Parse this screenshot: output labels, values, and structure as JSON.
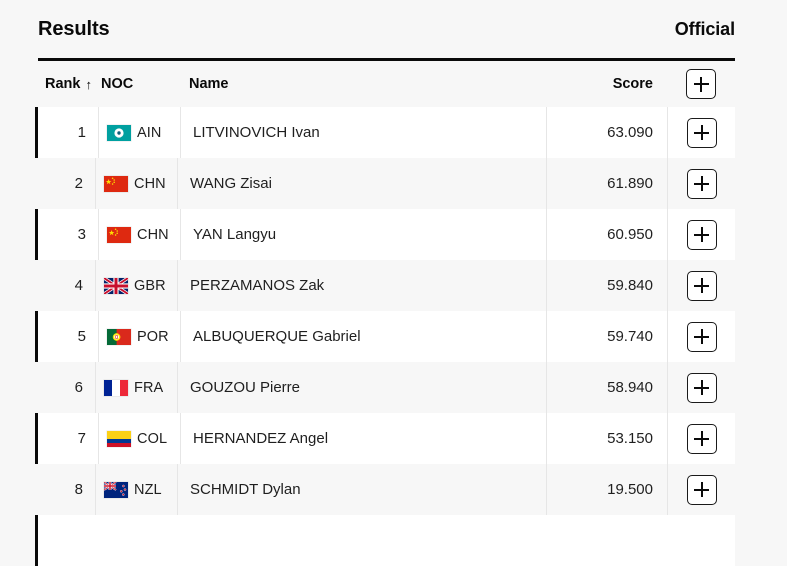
{
  "panel": {
    "title": "Results",
    "status": "Official"
  },
  "table": {
    "columns": {
      "rank": "Rank",
      "sort_indicator": "↑",
      "noc": "NOC",
      "name": "Name",
      "score": "Score",
      "expand_label": "+"
    },
    "rows": [
      {
        "rank": "1",
        "noc": "AIN",
        "flag": "flag-ain",
        "name": "LITVINOVICH Ivan",
        "score": "63.090",
        "expand_label": "+"
      },
      {
        "rank": "2",
        "noc": "CHN",
        "flag": "flag-chn",
        "name": "WANG Zisai",
        "score": "61.890",
        "expand_label": "+"
      },
      {
        "rank": "3",
        "noc": "CHN",
        "flag": "flag-chn",
        "name": "YAN Langyu",
        "score": "60.950",
        "expand_label": "+"
      },
      {
        "rank": "4",
        "noc": "GBR",
        "flag": "flag-gbr",
        "name": "PERZAMANOS Zak",
        "score": "59.840",
        "expand_label": "+"
      },
      {
        "rank": "5",
        "noc": "POR",
        "flag": "flag-por",
        "name": "ALBUQUERQUE Gabriel",
        "score": "59.740",
        "expand_label": "+"
      },
      {
        "rank": "6",
        "noc": "FRA",
        "flag": "flag-fra",
        "name": "GOUZOU Pierre",
        "score": "58.940",
        "expand_label": "+"
      },
      {
        "rank": "7",
        "noc": "COL",
        "flag": "flag-col",
        "name": "HERNANDEZ Angel",
        "score": "53.150",
        "expand_label": "+"
      },
      {
        "rank": "8",
        "noc": "NZL",
        "flag": "flag-nzl",
        "name": "SCHMIDT Dylan",
        "score": "19.500",
        "expand_label": "+"
      }
    ]
  },
  "colors": {
    "page_background": "#f7f7f7",
    "row_odd_background": "#ffffff",
    "row_even_background": "#f7f7f7",
    "rule": "#0a0a0a",
    "text": "#1f1f1f"
  }
}
